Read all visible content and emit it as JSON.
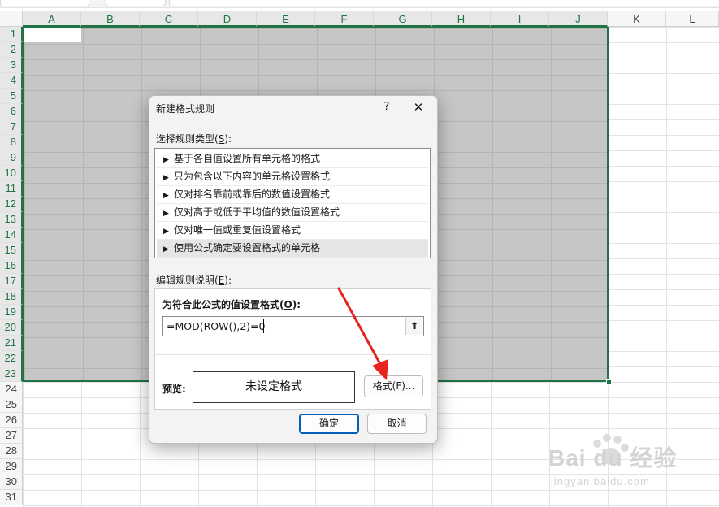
{
  "spreadsheet": {
    "columns": [
      "A",
      "B",
      "C",
      "D",
      "E",
      "F",
      "G",
      "H",
      "I",
      "J",
      "K",
      "L"
    ],
    "rows": [
      "1",
      "2",
      "3",
      "4",
      "5",
      "6",
      "7",
      "8",
      "9",
      "10",
      "11",
      "12",
      "13",
      "14",
      "15",
      "16",
      "17",
      "18",
      "19",
      "20",
      "21",
      "22",
      "23",
      "24",
      "25",
      "26",
      "27",
      "28",
      "29",
      "30",
      "31"
    ],
    "selection_color": "#217346"
  },
  "dialog": {
    "title": "新建格式规则",
    "help_glyph": "?",
    "close_glyph": "✕",
    "rule_type_label": "选择规则类型(",
    "rule_type_key": "S",
    "rule_type_label_end": "):",
    "rule_types": [
      "基于各自值设置所有单元格的格式",
      "只为包含以下内容的单元格设置格式",
      "仅对排名靠前或靠后的数值设置格式",
      "仅对高于或低于平均值的数值设置格式",
      "仅对唯一值或重复值设置格式",
      "使用公式确定要设置格式的单元格"
    ],
    "selected_rule_index": 5,
    "edit_label": "编辑规则说明(",
    "edit_key": "E",
    "edit_label_end": "):",
    "formula_heading": "为符合此公式的值设置格式(",
    "formula_heading_key": "O",
    "formula_heading_end": "):",
    "formula_value": "=MOD(ROW(),2)=0",
    "collapse_glyph": "⬆",
    "preview_label": "预览:",
    "preview_text": "未设定格式",
    "format_button": "格式(F)...",
    "ok_button": "确定",
    "cancel_button": "取消"
  },
  "annotation": {
    "arrow_color": "#e8231f"
  },
  "watermark": {
    "brand": "Bai du 经验",
    "url": "jingyan.baidu.com"
  }
}
